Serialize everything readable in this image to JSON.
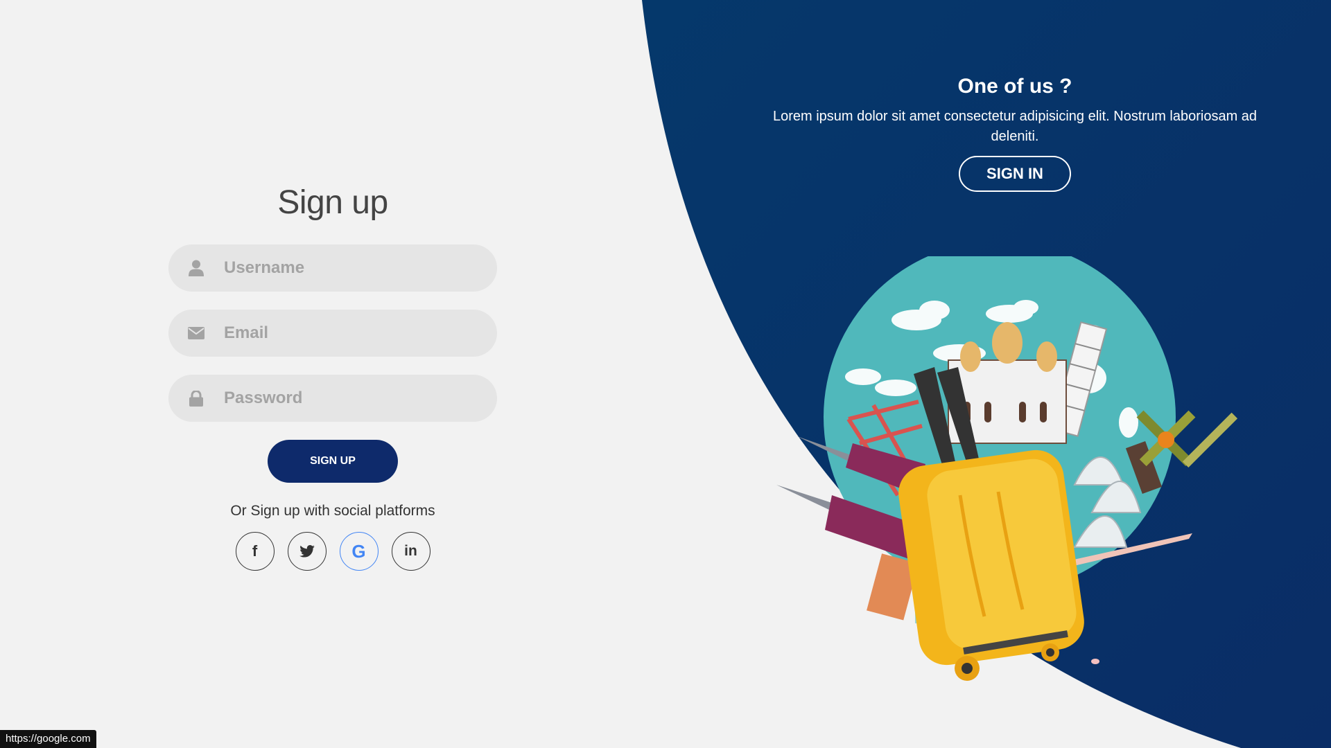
{
  "signup": {
    "title": "Sign up",
    "username_placeholder": "Username",
    "email_placeholder": "Email",
    "password_placeholder": "Password",
    "submit_label": "SIGN UP",
    "social_text": "Or Sign up with social platforms",
    "social": [
      {
        "name": "facebook",
        "icon": "facebook-icon",
        "label": "f"
      },
      {
        "name": "twitter",
        "icon": "twitter-icon"
      },
      {
        "name": "google",
        "icon": "google-icon",
        "label": "G",
        "color": "#4285f4"
      },
      {
        "name": "linkedin",
        "icon": "linkedin-icon",
        "label": "in"
      }
    ]
  },
  "info": {
    "title": "One of us ?",
    "text": "Lorem ipsum dolor sit amet consectetur adipisicing elit. Nostrum laboriosam ad deleniti.",
    "button_label": "SIGN IN"
  },
  "illustration": {
    "icon": "travel-suitcase-globe-illustration"
  },
  "status_bar": {
    "url": "https://google.com"
  },
  "colors": {
    "panel_blue": "#05386b",
    "button_blue": "#0e2a6b",
    "input_bg": "#e5e5e5",
    "page_bg": "#f2f2f2"
  }
}
